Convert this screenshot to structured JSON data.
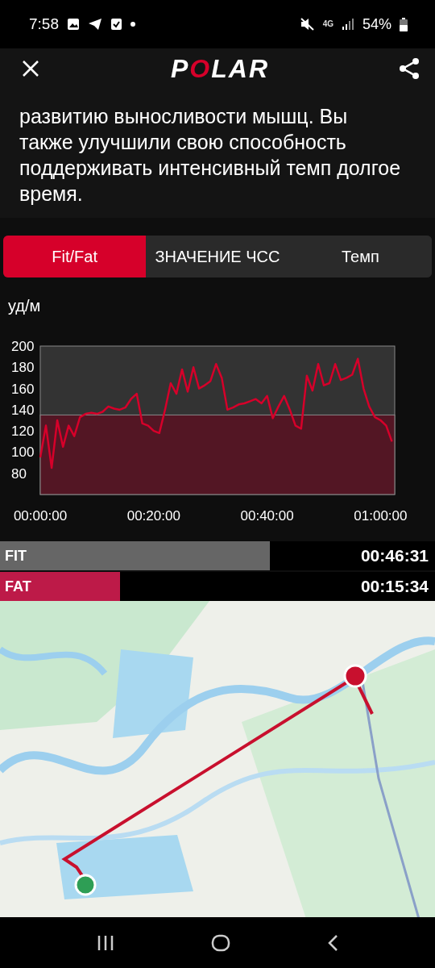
{
  "status_bar": {
    "time": "7:58",
    "network": "4G",
    "battery": "54%"
  },
  "header": {
    "logo": "POLAR"
  },
  "summary": "развитию выносливости мышц. Вы также улучшили свою способность поддерживать интенсивный темп долгое время.",
  "tabs": [
    {
      "label": "Fit/Fat",
      "selected": true
    },
    {
      "label": "ЗНАЧЕНИЕ ЧСС",
      "selected": false
    },
    {
      "label": "Темп",
      "selected": false
    }
  ],
  "chart": {
    "chart_data": {
      "type": "line",
      "ylabel": "уд/м",
      "xlim": [
        0,
        62.5
      ],
      "ylim": [
        60,
        200
      ],
      "yticks": [
        80,
        100,
        120,
        140,
        160,
        180,
        200
      ],
      "xticks": [
        {
          "value": 0,
          "label": "00:00:00"
        },
        {
          "value": 20,
          "label": "00:20:00"
        },
        {
          "value": 40,
          "label": "00:40:00"
        },
        {
          "value": 60,
          "label": "01:00:00"
        }
      ],
      "bands": [
        {
          "axis": "y",
          "from": 60,
          "to": 135,
          "color": "#531624"
        }
      ],
      "x": [
        0,
        1,
        2,
        3,
        4,
        5,
        6,
        7,
        8,
        9,
        10,
        11,
        12,
        13,
        14,
        15,
        16,
        17,
        18,
        19,
        20,
        21,
        22,
        23,
        24,
        25,
        26,
        27,
        28,
        29,
        30,
        31,
        32,
        33,
        34,
        35,
        36,
        37,
        38,
        39,
        40,
        41,
        42,
        43,
        44,
        45,
        46,
        47,
        48,
        49,
        50,
        51,
        52,
        53,
        54,
        55,
        56,
        57,
        58,
        59,
        60,
        61,
        62
      ],
      "series": [
        {
          "color": "#d6002a",
          "values": [
            95,
            125,
            85,
            130,
            105,
            125,
            115,
            133,
            136,
            137,
            136,
            138,
            143,
            141,
            140,
            142,
            150,
            155,
            127,
            125,
            120,
            118,
            140,
            165,
            155,
            178,
            157,
            180,
            160,
            163,
            167,
            183,
            170,
            140,
            142,
            145,
            146,
            148,
            150,
            146,
            153,
            132,
            143,
            153,
            140,
            125,
            122,
            172,
            158,
            183,
            163,
            165,
            183,
            168,
            170,
            173,
            188,
            160,
            143,
            133,
            130,
            125,
            110
          ]
        }
      ]
    }
  },
  "zones": [
    {
      "label": "FIT",
      "time": "00:46:31",
      "level": 0.62,
      "color": "#666666"
    },
    {
      "label": "FAT",
      "time": "00:15:34",
      "level": 0.275,
      "color": "#bd1a48"
    }
  ]
}
